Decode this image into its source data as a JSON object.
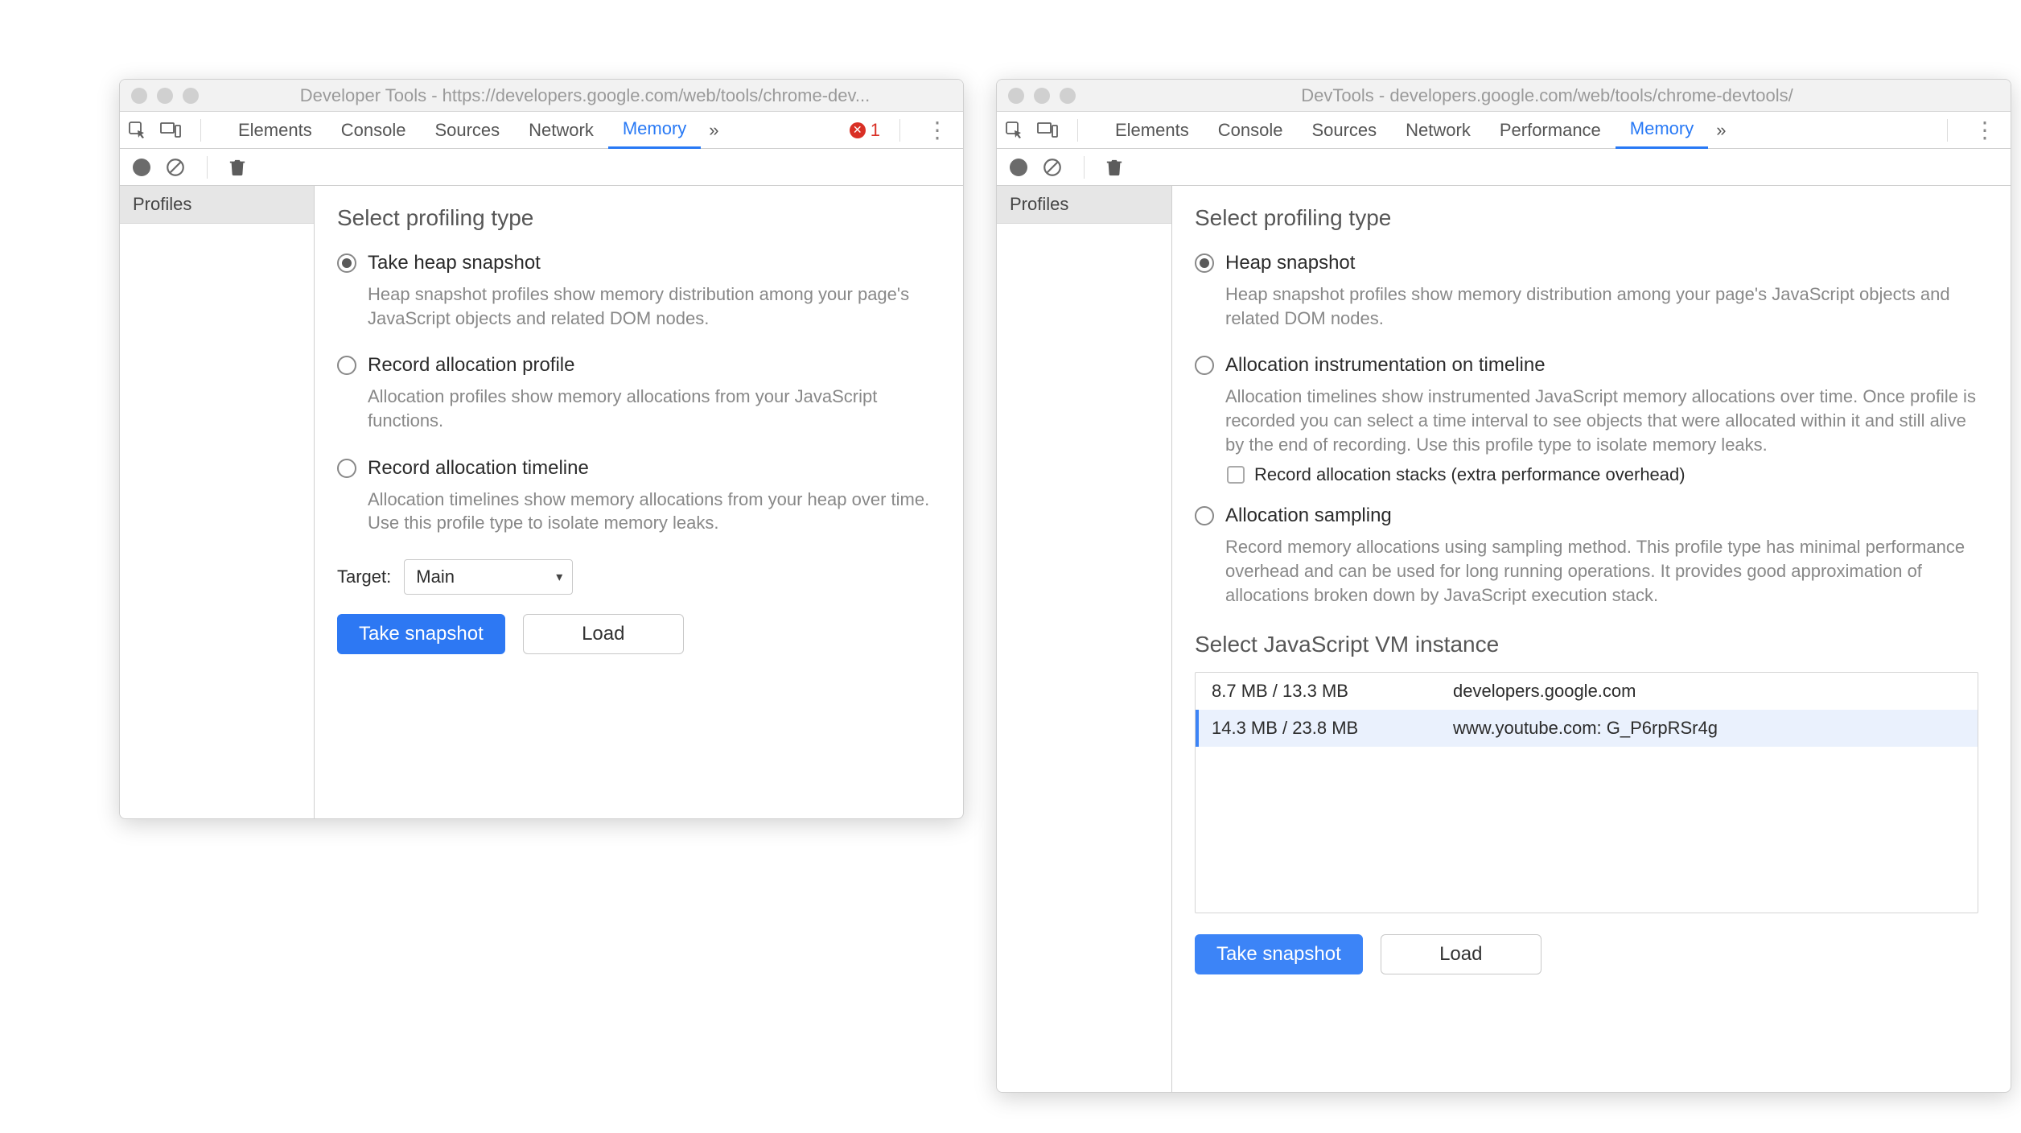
{
  "left": {
    "title": "Developer Tools - https://developers.google.com/web/tools/chrome-dev...",
    "tabs": [
      "Elements",
      "Console",
      "Sources",
      "Network",
      "Memory"
    ],
    "active_tab_index": 4,
    "error_count": "1",
    "sidebar": {
      "profiles_label": "Profiles"
    },
    "section_title": "Select profiling type",
    "options": [
      {
        "title": "Take heap snapshot",
        "desc": "Heap snapshot profiles show memory distribution among your page's JavaScript objects and related DOM nodes.",
        "checked": true
      },
      {
        "title": "Record allocation profile",
        "desc": "Allocation profiles show memory allocations from your JavaScript functions.",
        "checked": false
      },
      {
        "title": "Record allocation timeline",
        "desc": "Allocation timelines show memory allocations from your heap over time. Use this profile type to isolate memory leaks.",
        "checked": false
      }
    ],
    "target_label": "Target:",
    "target_value": "Main",
    "buttons": {
      "primary": "Take snapshot",
      "load": "Load"
    }
  },
  "right": {
    "title": "DevTools - developers.google.com/web/tools/chrome-devtools/",
    "tabs": [
      "Elements",
      "Console",
      "Sources",
      "Network",
      "Performance",
      "Memory"
    ],
    "active_tab_index": 5,
    "sidebar": {
      "profiles_label": "Profiles"
    },
    "section_title": "Select profiling type",
    "options": [
      {
        "title": "Heap snapshot",
        "desc": "Heap snapshot profiles show memory distribution among your page's JavaScript objects and related DOM nodes.",
        "checked": true
      },
      {
        "title": "Allocation instrumentation on timeline",
        "desc": "Allocation timelines show instrumented JavaScript memory allocations over time. Once profile is recorded you can select a time interval to see objects that were allocated within it and still alive by the end of recording. Use this profile type to isolate memory leaks.",
        "checked": false,
        "sub_checkbox_label": "Record allocation stacks (extra performance overhead)"
      },
      {
        "title": "Allocation sampling",
        "desc": "Record memory allocations using sampling method. This profile type has minimal performance overhead and can be used for long running operations. It provides good approximation of allocations broken down by JavaScript execution stack.",
        "checked": false
      }
    ],
    "vm_title": "Select JavaScript VM instance",
    "vm_instances": [
      {
        "size": "8.7 MB / 13.3 MB",
        "host": "developers.google.com",
        "selected": false
      },
      {
        "size": "14.3 MB / 23.8 MB",
        "host": "www.youtube.com: G_P6rpRSr4g",
        "selected": true
      }
    ],
    "buttons": {
      "primary": "Take snapshot",
      "load": "Load"
    }
  }
}
